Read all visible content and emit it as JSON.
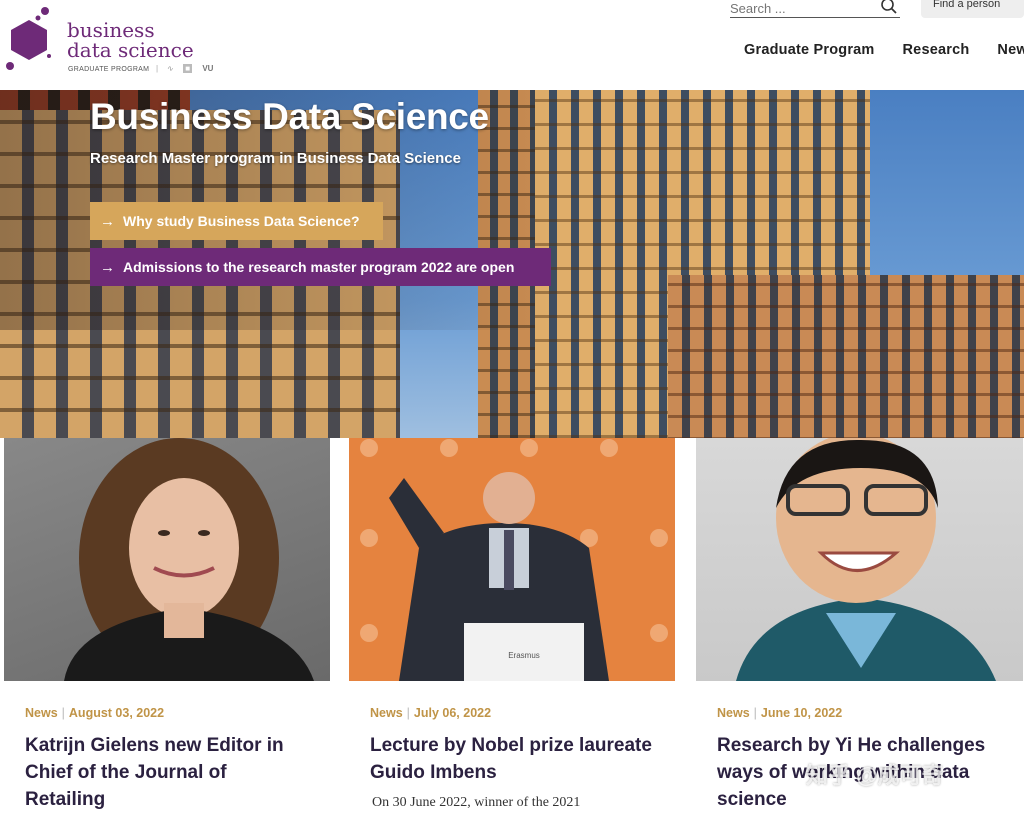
{
  "header": {
    "logo": {
      "line1": "business",
      "line2": "data science",
      "subtitle": "GRADUATE PROGRAM",
      "partners": "VU"
    },
    "search": {
      "placeholder": "Search ..."
    },
    "find_person": "Find a person",
    "nav": [
      "Graduate Program",
      "Research",
      "News"
    ]
  },
  "hero": {
    "title": "Business Data Science",
    "subtitle": "Research Master program in Business Data Science",
    "buttons": [
      {
        "label": "Why study Business Data Science?",
        "color": "#d6a65b"
      },
      {
        "label": "Admissions to the research master program 2022 are open",
        "color": "#6e2a78"
      }
    ]
  },
  "cards": [
    {
      "category": "News",
      "date": "August 03, 2022",
      "title": "Katrijn Gielens new Editor in Chief of the Journal of Retailing",
      "excerpt": ""
    },
    {
      "category": "News",
      "date": "July 06, 2022",
      "title": "Lecture by Nobel prize laureate Guido Imbens",
      "excerpt": "On 30 June 2022, winner of the 2021"
    },
    {
      "category": "News",
      "date": "June 10, 2022",
      "title": "Research by Yi He challenges ways of working within data science",
      "excerpt": ""
    }
  ],
  "watermark": "知乎 @成可奇",
  "colors": {
    "brand_purple": "#6e2a78",
    "accent_gold": "#d6a65b",
    "meta_gold": "#c09447"
  }
}
